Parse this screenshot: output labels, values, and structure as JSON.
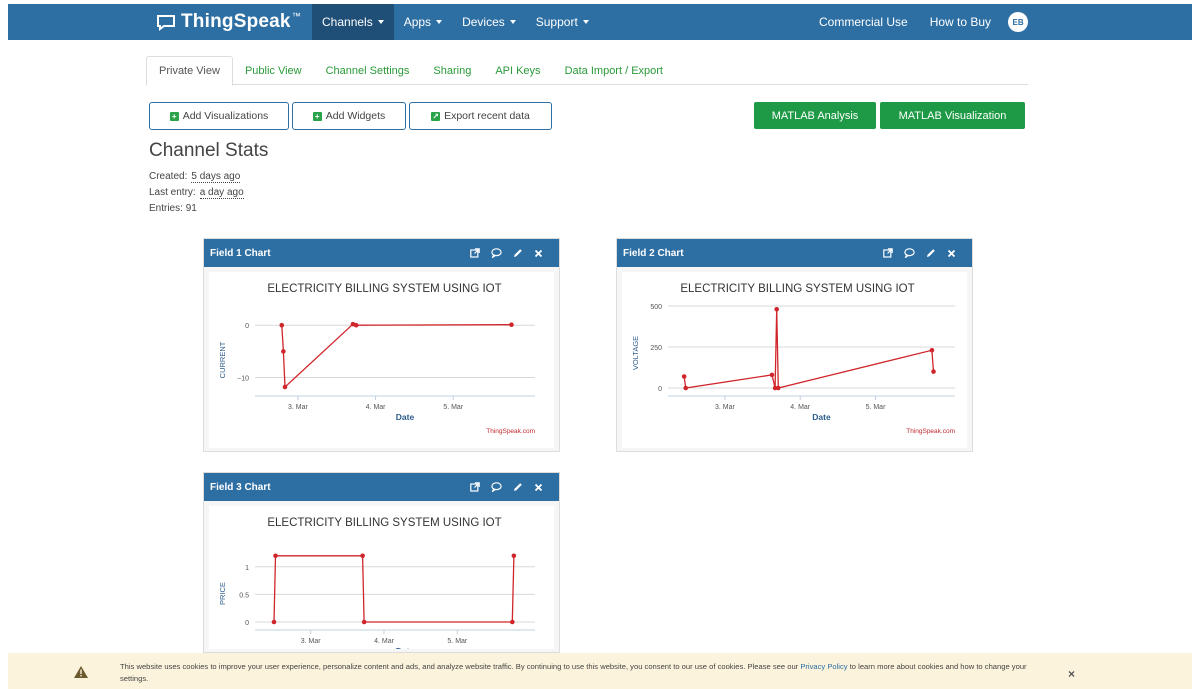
{
  "navbar": {
    "brand": "ThingSpeak",
    "tm": "™",
    "menu": [
      "Channels",
      "Apps",
      "Devices",
      "Support"
    ],
    "right": [
      "Commercial Use",
      "How to Buy"
    ],
    "avatar_initials": "EB"
  },
  "tabs": [
    "Private View",
    "Public View",
    "Channel Settings",
    "Sharing",
    "API Keys",
    "Data Import / Export"
  ],
  "buttons": {
    "add_visualizations": "Add Visualizations",
    "add_widgets": "Add Widgets",
    "export_recent": "Export recent data",
    "matlab_analysis": "MATLAB Analysis",
    "matlab_visualization": "MATLAB Visualization"
  },
  "stats": {
    "title": "Channel Stats",
    "created_label": "Created:",
    "created_value": "5 days ago",
    "last_entry_label": "Last entry:",
    "last_entry_value": "a day ago",
    "entries_label": "Entries:",
    "entries_value": "91"
  },
  "charts": [
    {
      "panel_title": "Field 1 Chart",
      "title": "ELECTRICITY BILLING SYSTEM USING IOT",
      "ylabel": "CURRENT",
      "xlabel": "Date",
      "credit": "ThingSpeak.com",
      "yticks": [
        "0",
        "−10"
      ],
      "xticks": [
        "3. Mar",
        "4. Mar",
        "5. Mar"
      ]
    },
    {
      "panel_title": "Field 2 Chart",
      "title": "ELECTRICITY BILLING SYSTEM USING IOT",
      "ylabel": "VOLTAGE",
      "xlabel": "Date",
      "credit": "ThingSpeak.com",
      "yticks": [
        "500",
        "250",
        "0"
      ],
      "xticks": [
        "3. Mar",
        "4. Mar",
        "5. Mar"
      ]
    },
    {
      "panel_title": "Field 3 Chart",
      "title": "ELECTRICITY BILLING SYSTEM USING IOT",
      "ylabel": "PRICE",
      "xlabel": "Date",
      "yticks": [
        "1",
        "0.5",
        "0"
      ],
      "xticks": [
        "3. Mar",
        "4. Mar",
        "5. Mar"
      ]
    }
  ],
  "chart_data": [
    {
      "type": "line",
      "title": "ELECTRICITY BILLING SYSTEM USING IOT",
      "xlabel": "Date",
      "ylabel": "CURRENT",
      "x_ticks": [
        "3. Mar",
        "4. Mar",
        "5. Mar"
      ],
      "ylim": [
        -12,
        1
      ],
      "series": [
        {
          "x": [
            "2 Mar 19:00",
            "2 Mar 19:30",
            "2 Mar 20:00",
            "3 Mar 17:00",
            "3 Mar 18:00",
            "5 Mar 18:00"
          ],
          "values": [
            0,
            -5,
            -11.8,
            0.2,
            0,
            0.1
          ]
        }
      ]
    },
    {
      "type": "line",
      "title": "ELECTRICITY BILLING SYSTEM USING IOT",
      "xlabel": "Date",
      "ylabel": "VOLTAGE",
      "x_ticks": [
        "3. Mar",
        "4. Mar",
        "5. Mar"
      ],
      "ylim": [
        0,
        520
      ],
      "series": [
        {
          "x": [
            "2 Mar 11:00",
            "2 Mar 11:30",
            "3 Mar 15:00",
            "3 Mar 16:00",
            "3 Mar 16:30",
            "3 Mar 17:00",
            "5 Mar 18:00",
            "5 Mar 18:30"
          ],
          "values": [
            70,
            0,
            80,
            0,
            480,
            0,
            230,
            100
          ]
        }
      ]
    },
    {
      "type": "line",
      "title": "ELECTRICITY BILLING SYSTEM USING IOT",
      "xlabel": "Date",
      "ylabel": "PRICE",
      "x_ticks": [
        "3. Mar",
        "4. Mar",
        "5. Mar"
      ],
      "ylim": [
        0,
        1.25
      ],
      "series": [
        {
          "x": [
            "2 Mar 12:00",
            "2 Mar 12:30",
            "3 Mar 17:00",
            "3 Mar 17:30",
            "5 Mar 18:00",
            "5 Mar 18:30"
          ],
          "values": [
            0,
            1.2,
            1.2,
            0,
            0,
            1.2
          ]
        }
      ]
    }
  ],
  "cookie": {
    "text_before": "This website uses cookies to improve your user experience, personalize content and ads, and analyze website traffic. By continuing to use this website, you consent to our use of cookies. Please see our ",
    "link": "Privacy Policy",
    "text_after": " to learn more about cookies and how to change your settings.",
    "close": "×"
  },
  "colors": {
    "navbar": "#2d6ea3",
    "green_button": "#1e9a46",
    "series": "#d0262b",
    "tab_link": "#2a9a3a"
  }
}
